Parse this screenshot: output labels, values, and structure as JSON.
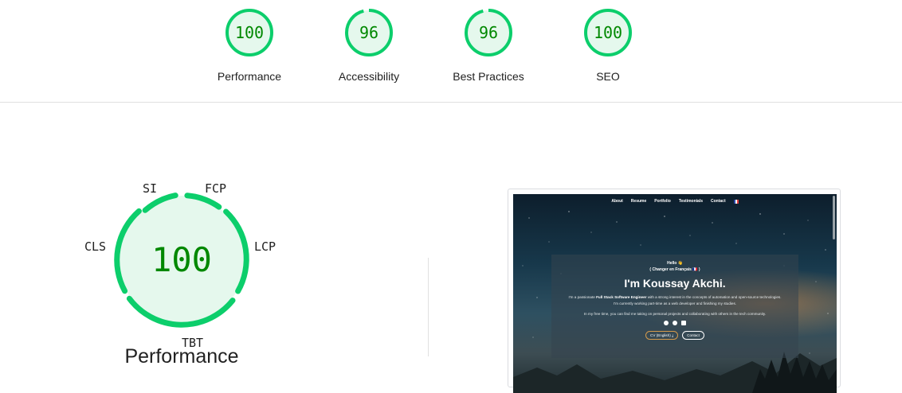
{
  "categories": [
    {
      "score": "100",
      "label": "Performance",
      "value": 100
    },
    {
      "score": "96",
      "label": "Accessibility",
      "value": 96
    },
    {
      "score": "96",
      "label": "Best Practices",
      "value": 96
    },
    {
      "score": "100",
      "label": "SEO",
      "value": 100
    }
  ],
  "performance": {
    "score": "100",
    "title": "Performance",
    "metrics": {
      "si": "SI",
      "fcp": "FCP",
      "lcp": "LCP",
      "tbt": "TBT",
      "cls": "CLS"
    }
  },
  "colors": {
    "pass": "#0cce6b",
    "pass_fill": "#e5f8ed",
    "pass_text": "#008800"
  },
  "thumbnail": {
    "nav": [
      "About",
      "Resume",
      "Portfolio",
      "Testimonials",
      "Contact"
    ],
    "hello": "Hello 👋",
    "lang_switch": "( Changer en Français 🇫🇷 )",
    "name": "I'm Koussay Akchi.",
    "desc_prefix": "I'm a passionate ",
    "desc_strong": "Full Stack Software Engineer",
    "desc_suffix": " with a strong interest in the concepts of automation and open-source technologies. I'm currently working part-time as a web developer and finishing my studies.",
    "free_time": "In my free time, you can find me taking on personal projects and collaborating with others in the tech community.",
    "cv_button": "CV (English) ⤓",
    "contact_button": "Contact"
  }
}
